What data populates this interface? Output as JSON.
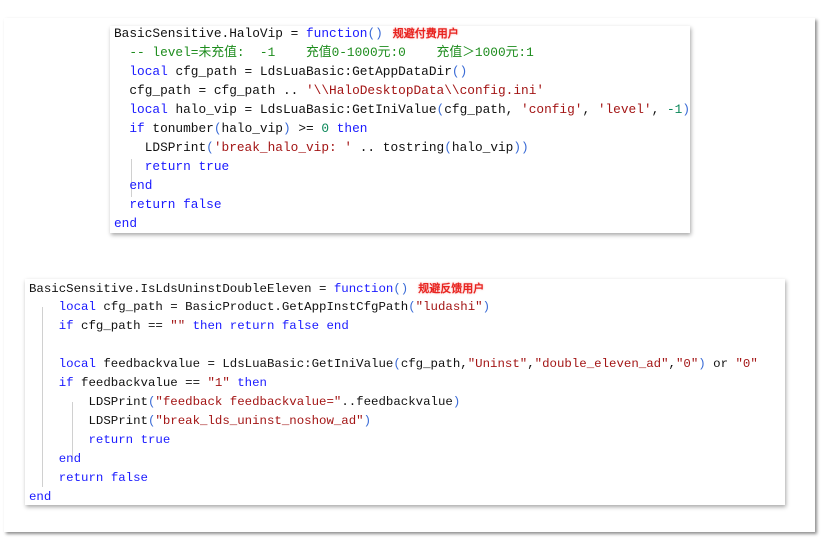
{
  "colors": {
    "keyword": "#1a1aff",
    "string": "#a31515",
    "comment": "#1d8c1d",
    "number": "#098658",
    "annotation": "#e8231f"
  },
  "blocks": [
    {
      "annotation": "规避付费用户",
      "lines": [
        [
          [
            "BasicSensitive.HaloVip = ",
            "pl"
          ],
          [
            "function",
            "kw"
          ],
          [
            "()",
            "par"
          ]
        ],
        [
          [
            "  -- level=未充值:  -1    充值0-1000元:0    充值＞1000元:1",
            "cm"
          ]
        ],
        [
          [
            "  ",
            "pl"
          ],
          [
            "local",
            "kw"
          ],
          [
            " cfg_path = LdsLuaBasic:GetAppDataDir",
            "pl"
          ],
          [
            "()",
            "par"
          ]
        ],
        [
          [
            "  cfg_path = cfg_path .. ",
            "pl"
          ],
          [
            "'\\\\HaloDesktopData\\\\config.ini'",
            "str"
          ]
        ],
        [
          [
            "  ",
            "pl"
          ],
          [
            "local",
            "kw"
          ],
          [
            " halo_vip = LdsLuaBasic:GetIniValue",
            "pl"
          ],
          [
            "(",
            "par"
          ],
          [
            "cfg_path, ",
            "pl"
          ],
          [
            "'config'",
            "str"
          ],
          [
            ", ",
            "pl"
          ],
          [
            "'level'",
            "str"
          ],
          [
            ", ",
            "pl"
          ],
          [
            "-1",
            "num"
          ],
          [
            ")",
            "par"
          ]
        ],
        [
          [
            "  ",
            "pl"
          ],
          [
            "if",
            "kw"
          ],
          [
            " tonumber",
            "pl"
          ],
          [
            "(",
            "par"
          ],
          [
            "halo_vip",
            "pl"
          ],
          [
            ")",
            "par"
          ],
          [
            " >= ",
            "pl"
          ],
          [
            "0",
            "num"
          ],
          [
            " ",
            "pl"
          ],
          [
            "then",
            "kw"
          ]
        ],
        [
          [
            "    LDSPrint",
            "pl"
          ],
          [
            "(",
            "par"
          ],
          [
            "'break_halo_vip: '",
            "str"
          ],
          [
            " .. tostring",
            "pl"
          ],
          [
            "(",
            "par"
          ],
          [
            "halo_vip",
            "pl"
          ],
          [
            "))",
            "par"
          ]
        ],
        [
          [
            "    ",
            "pl"
          ],
          [
            "return",
            "kw"
          ],
          [
            " ",
            "pl"
          ],
          [
            "true",
            "kw"
          ]
        ],
        [
          [
            "  ",
            "pl"
          ],
          [
            "end",
            "kw"
          ]
        ],
        [
          [
            "  ",
            "pl"
          ],
          [
            "return",
            "kw"
          ],
          [
            " ",
            "pl"
          ],
          [
            "false",
            "kw"
          ]
        ],
        [
          [
            "end",
            "kw"
          ]
        ]
      ]
    },
    {
      "annotation": "规避反馈用户",
      "lines": [
        [
          [
            "BasicSensitive.IsLdsUninstDoubleEleven = ",
            "pl"
          ],
          [
            "function",
            "kw"
          ],
          [
            "()",
            "par"
          ]
        ],
        [
          [
            "    ",
            "pl"
          ],
          [
            "local",
            "kw"
          ],
          [
            " cfg_path = BasicProduct.GetAppInstCfgPath",
            "pl"
          ],
          [
            "(",
            "par"
          ],
          [
            "\"ludashi\"",
            "str"
          ],
          [
            ")",
            "par"
          ]
        ],
        [
          [
            "    ",
            "pl"
          ],
          [
            "if",
            "kw"
          ],
          [
            " cfg_path == ",
            "pl"
          ],
          [
            "\"\"",
            "str"
          ],
          [
            " ",
            "pl"
          ],
          [
            "then",
            "kw"
          ],
          [
            " ",
            "pl"
          ],
          [
            "return",
            "kw"
          ],
          [
            " ",
            "pl"
          ],
          [
            "false",
            "kw"
          ],
          [
            " ",
            "pl"
          ],
          [
            "end",
            "kw"
          ]
        ],
        [
          [
            "",
            "pl"
          ]
        ],
        [
          [
            "    ",
            "pl"
          ],
          [
            "local",
            "kw"
          ],
          [
            " feedbackvalue = LdsLuaBasic:GetIniValue",
            "pl"
          ],
          [
            "(",
            "par"
          ],
          [
            "cfg_path,",
            "pl"
          ],
          [
            "\"Uninst\"",
            "str"
          ],
          [
            ",",
            "pl"
          ],
          [
            "\"double_eleven_ad\"",
            "str"
          ],
          [
            ",",
            "pl"
          ],
          [
            "\"0\"",
            "str"
          ],
          [
            ")",
            "par"
          ],
          [
            " or ",
            "pl"
          ],
          [
            "\"0\"",
            "str"
          ]
        ],
        [
          [
            "    ",
            "pl"
          ],
          [
            "if",
            "kw"
          ],
          [
            " feedbackvalue == ",
            "pl"
          ],
          [
            "\"1\"",
            "str"
          ],
          [
            " ",
            "pl"
          ],
          [
            "then",
            "kw"
          ]
        ],
        [
          [
            "        LDSPrint",
            "pl"
          ],
          [
            "(",
            "par"
          ],
          [
            "\"feedback feedbackvalue=\"",
            "str"
          ],
          [
            "..feedbackvalue",
            "pl"
          ],
          [
            ")",
            "par"
          ]
        ],
        [
          [
            "        LDSPrint",
            "pl"
          ],
          [
            "(",
            "par"
          ],
          [
            "\"break_lds_uninst_noshow_ad\"",
            "str"
          ],
          [
            ")",
            "par"
          ]
        ],
        [
          [
            "        ",
            "pl"
          ],
          [
            "return",
            "kw"
          ],
          [
            " ",
            "pl"
          ],
          [
            "true",
            "kw"
          ]
        ],
        [
          [
            "    ",
            "pl"
          ],
          [
            "end",
            "kw"
          ]
        ],
        [
          [
            "    ",
            "pl"
          ],
          [
            "return",
            "kw"
          ],
          [
            " ",
            "pl"
          ],
          [
            "false",
            "kw"
          ]
        ],
        [
          [
            "end",
            "kw"
          ]
        ]
      ]
    }
  ]
}
